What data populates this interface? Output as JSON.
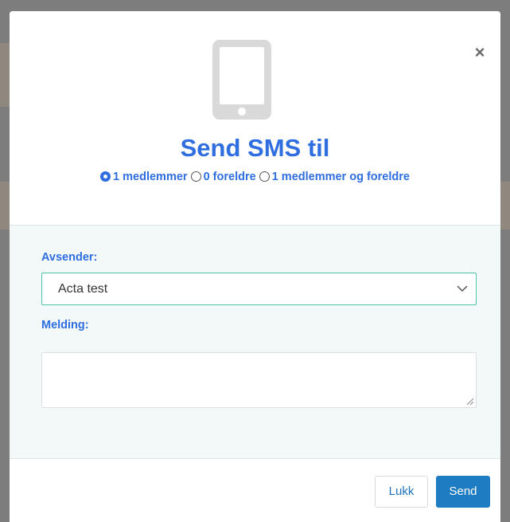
{
  "modal": {
    "title": "Send SMS til",
    "close_symbol": "×",
    "icon": "mobile-phone-icon",
    "recipients": {
      "options": [
        {
          "label": "1 medlemmer",
          "checked": true
        },
        {
          "label": "0 foreldre",
          "checked": false
        },
        {
          "label": "1 medlemmer og foreldre",
          "checked": false
        }
      ]
    },
    "sender": {
      "label": "Avsender:",
      "value": "Acta test"
    },
    "message": {
      "label": "Melding:",
      "value": ""
    },
    "buttons": {
      "close_label": "Lukk",
      "send_label": "Send"
    }
  },
  "colors": {
    "accent_blue": "#2f6ee0",
    "primary_button": "#1e7cc3",
    "body_background": "#f3f9f9",
    "select_border": "#4ec3a8",
    "icon_gray": "#d9d9d9"
  }
}
